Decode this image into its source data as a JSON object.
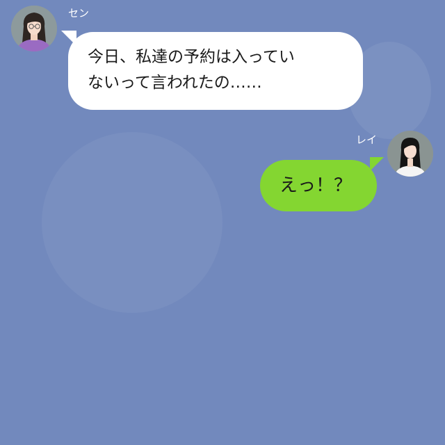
{
  "colors": {
    "background": "#7289bd",
    "incoming_bubble": "#ffffff",
    "outgoing_bubble": "#84d631",
    "name_text": "#ffffff"
  },
  "messages": [
    {
      "sender": "セン",
      "direction": "incoming",
      "avatar_icon": "woman-glasses-purple-shirt-icon",
      "lines": [
        "今日、私達の予約は入ってい",
        "ないって言われたの……"
      ]
    },
    {
      "sender": "レイ",
      "direction": "outgoing",
      "avatar_icon": "woman-long-black-hair-icon",
      "text": "えっ！？"
    }
  ]
}
